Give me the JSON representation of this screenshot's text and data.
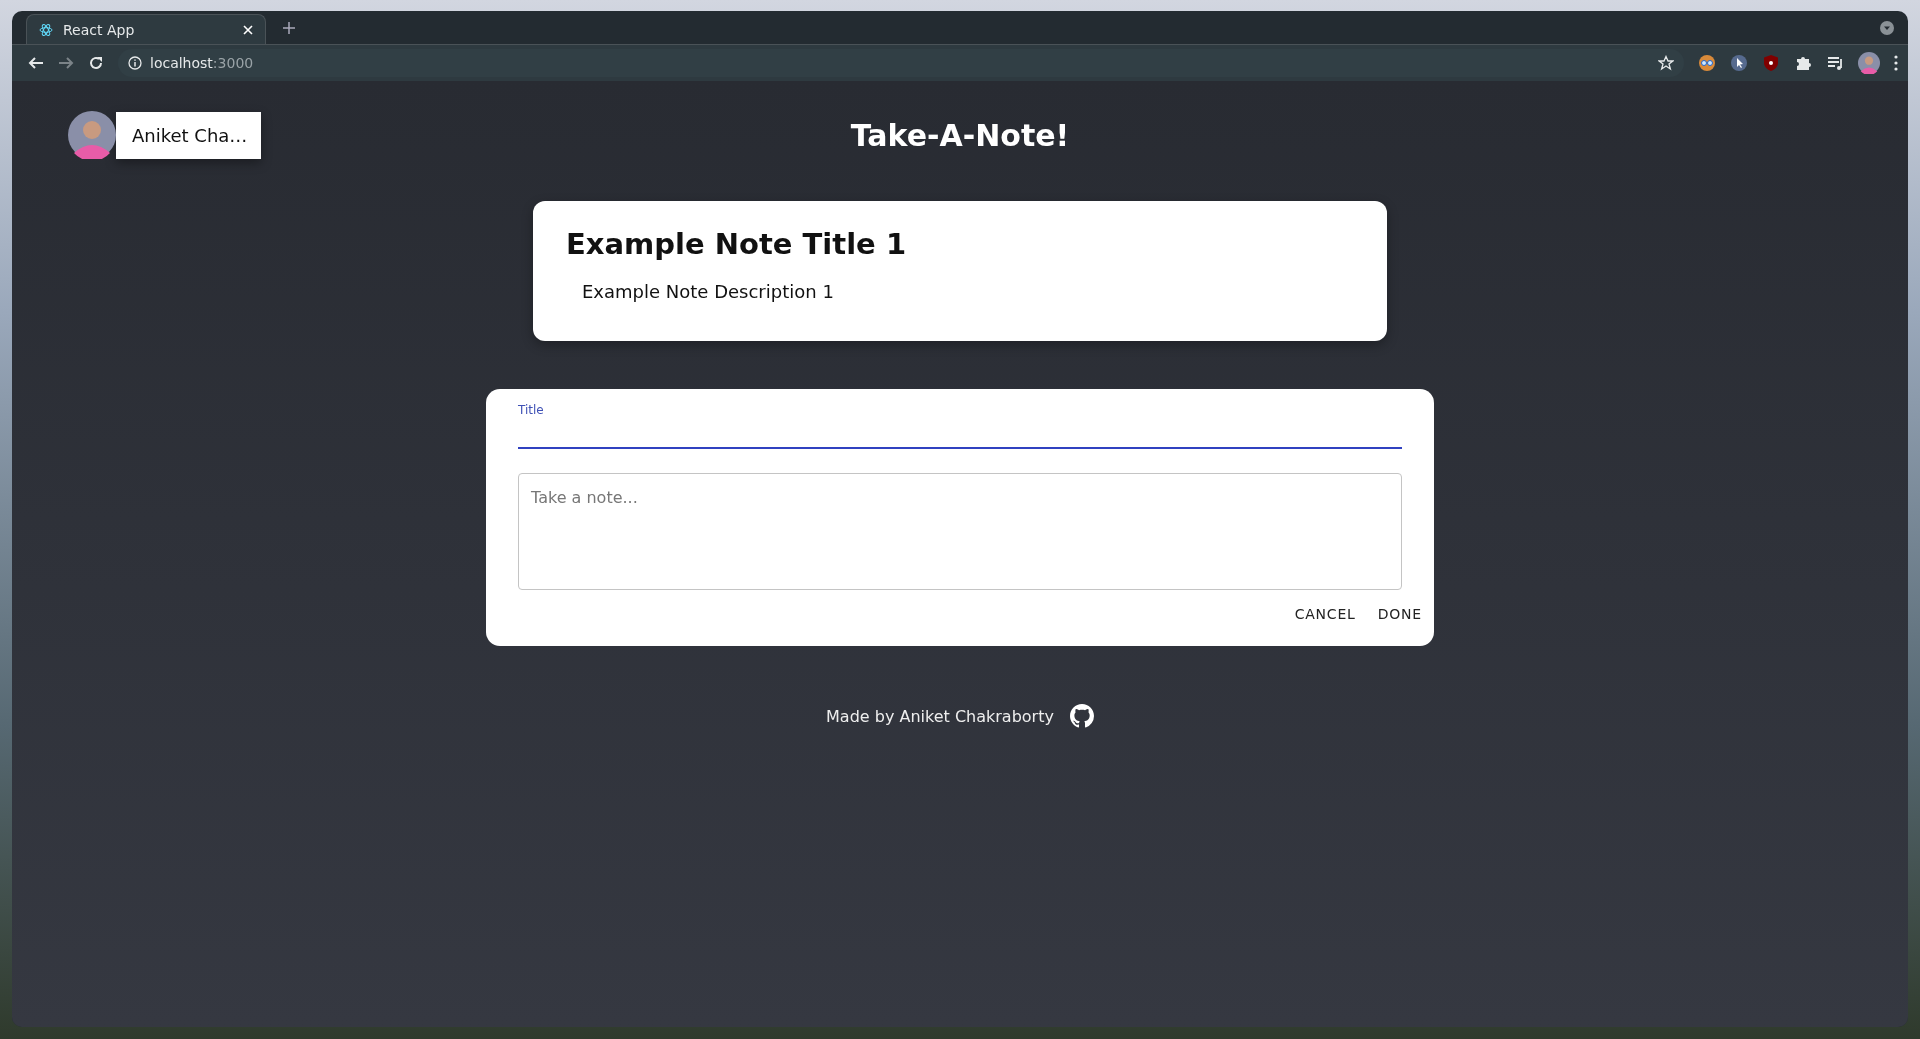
{
  "browser": {
    "tabs": [
      {
        "title": "React App",
        "selected": true
      }
    ],
    "url_host": "localhost",
    "url_port": ":3000"
  },
  "user_chip": {
    "name": "Aniket Cha…"
  },
  "app_title": "Take-A-Note!",
  "notes": [
    {
      "title": "Example Note Title 1",
      "description": "Example Note Description 1"
    }
  ],
  "form": {
    "title_field": {
      "label": "Title",
      "focused": true
    },
    "note_field": {
      "placeholder": "Take a note..."
    },
    "buttons": [
      "CANCEL",
      "DONE"
    ]
  },
  "footer": {
    "text": "Made by Aniket Chakraborty"
  }
}
